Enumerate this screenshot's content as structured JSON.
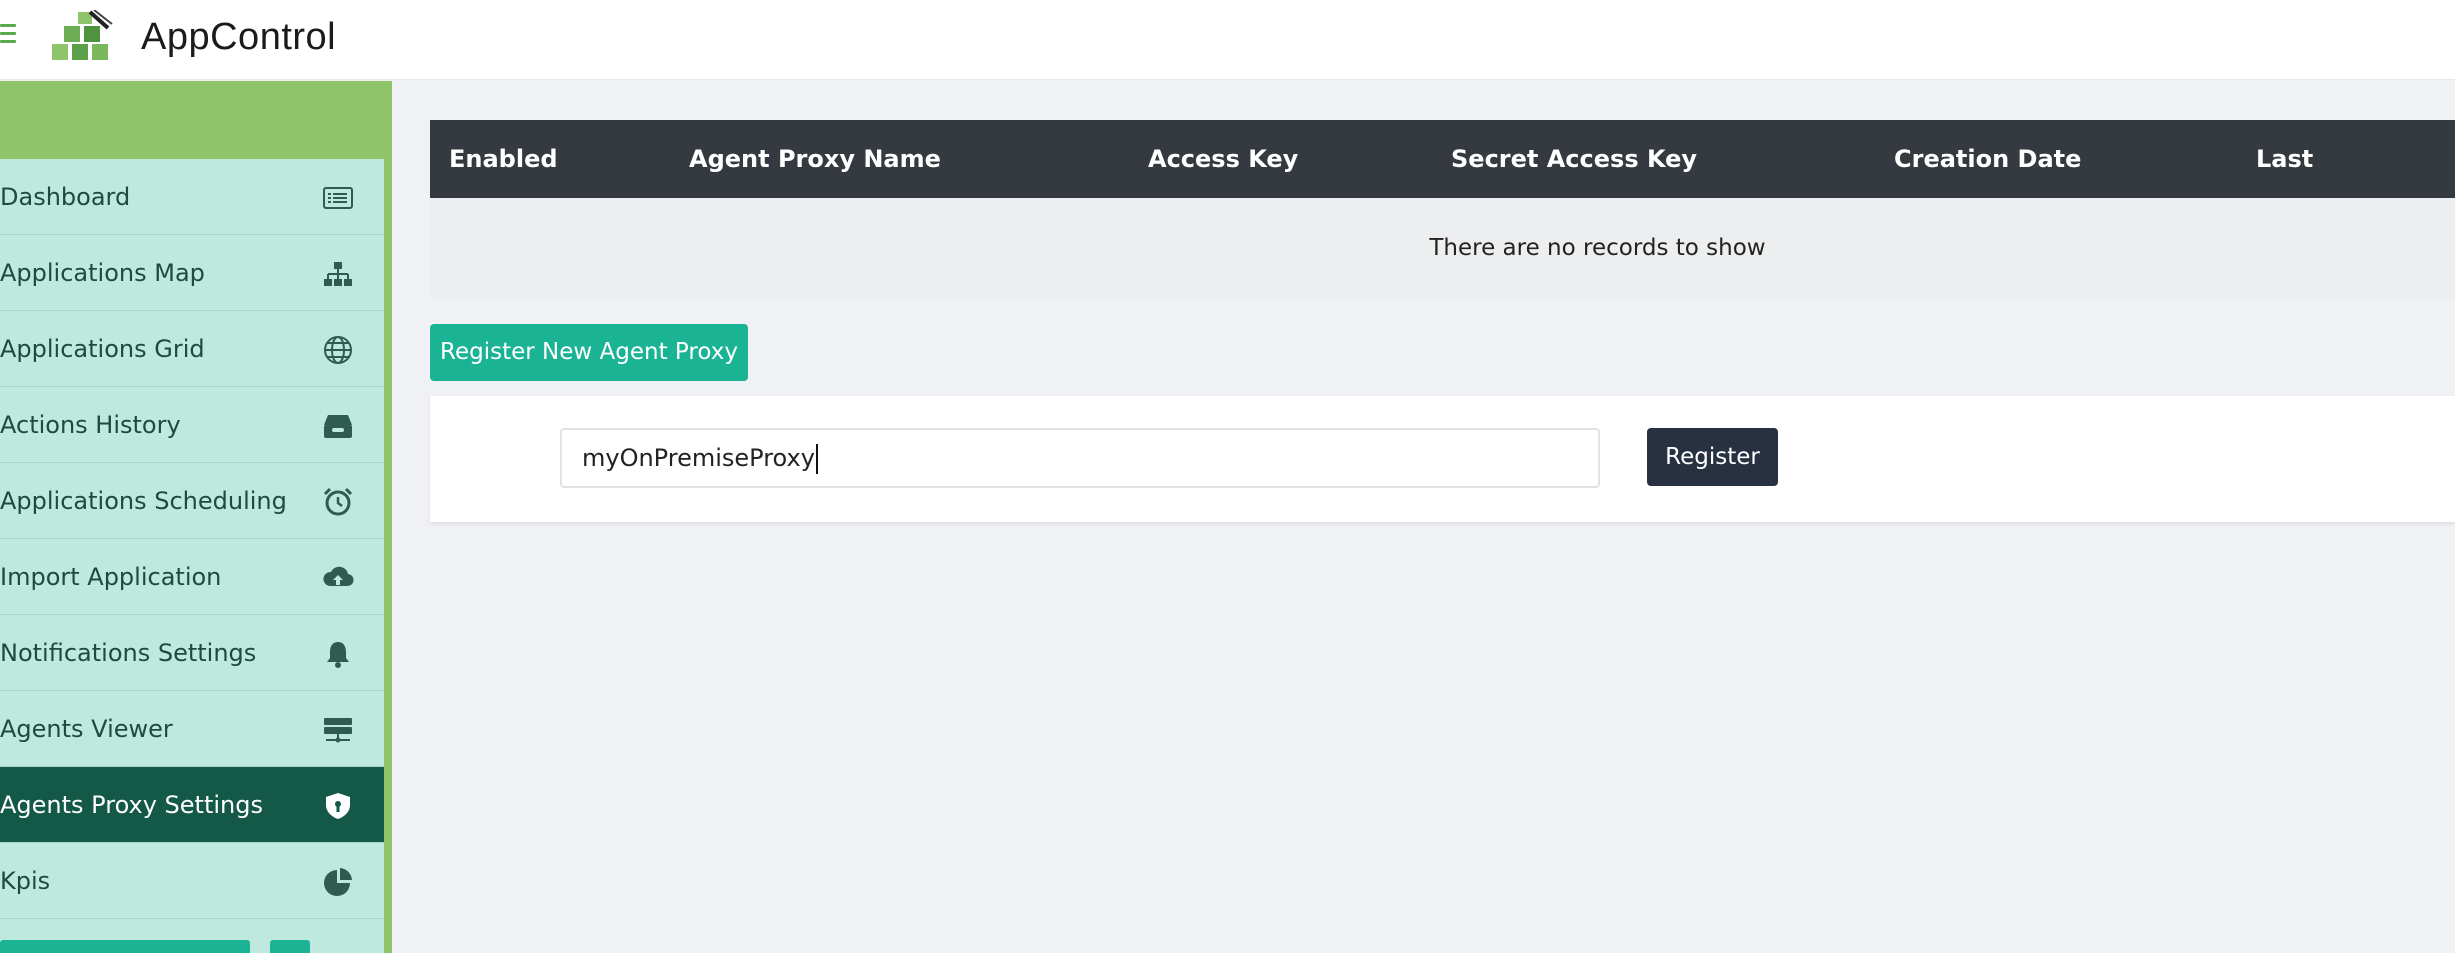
{
  "header": {
    "title": "AppControl"
  },
  "sidebar": {
    "items": [
      {
        "label": "Dashboard",
        "icon": "list-icon"
      },
      {
        "label": "Applications Map",
        "icon": "sitemap-icon"
      },
      {
        "label": "Applications Grid",
        "icon": "globe-icon"
      },
      {
        "label": "Actions History",
        "icon": "inbox-icon"
      },
      {
        "label": "Applications Scheduling",
        "icon": "alarm-clock-icon"
      },
      {
        "label": "Import Application",
        "icon": "cloud-upload-icon"
      },
      {
        "label": "Notifications Settings",
        "icon": "bell-icon"
      },
      {
        "label": "Agents Viewer",
        "icon": "network-server-icon"
      },
      {
        "label": "Agents Proxy Settings",
        "icon": "shield-icon",
        "active": true
      },
      {
        "label": "Kpis",
        "icon": "pie-chart-icon"
      }
    ]
  },
  "table": {
    "columns": [
      "Enabled",
      "Agent Proxy Name",
      "Access Key",
      "Secret Access Key",
      "Creation Date",
      "Last Heartbeat"
    ],
    "empty_text": "There are no records to show"
  },
  "actions": {
    "register_new_label": "Register New Agent Proxy"
  },
  "form": {
    "name_value": "myOnPremiseProxy",
    "register_label": "Register"
  },
  "colors": {
    "accent": "#1ab394",
    "sidebar_green": "#8fc46b",
    "menu_bg": "#bfe9df",
    "active_bg": "#145847",
    "table_header": "#343a40"
  }
}
